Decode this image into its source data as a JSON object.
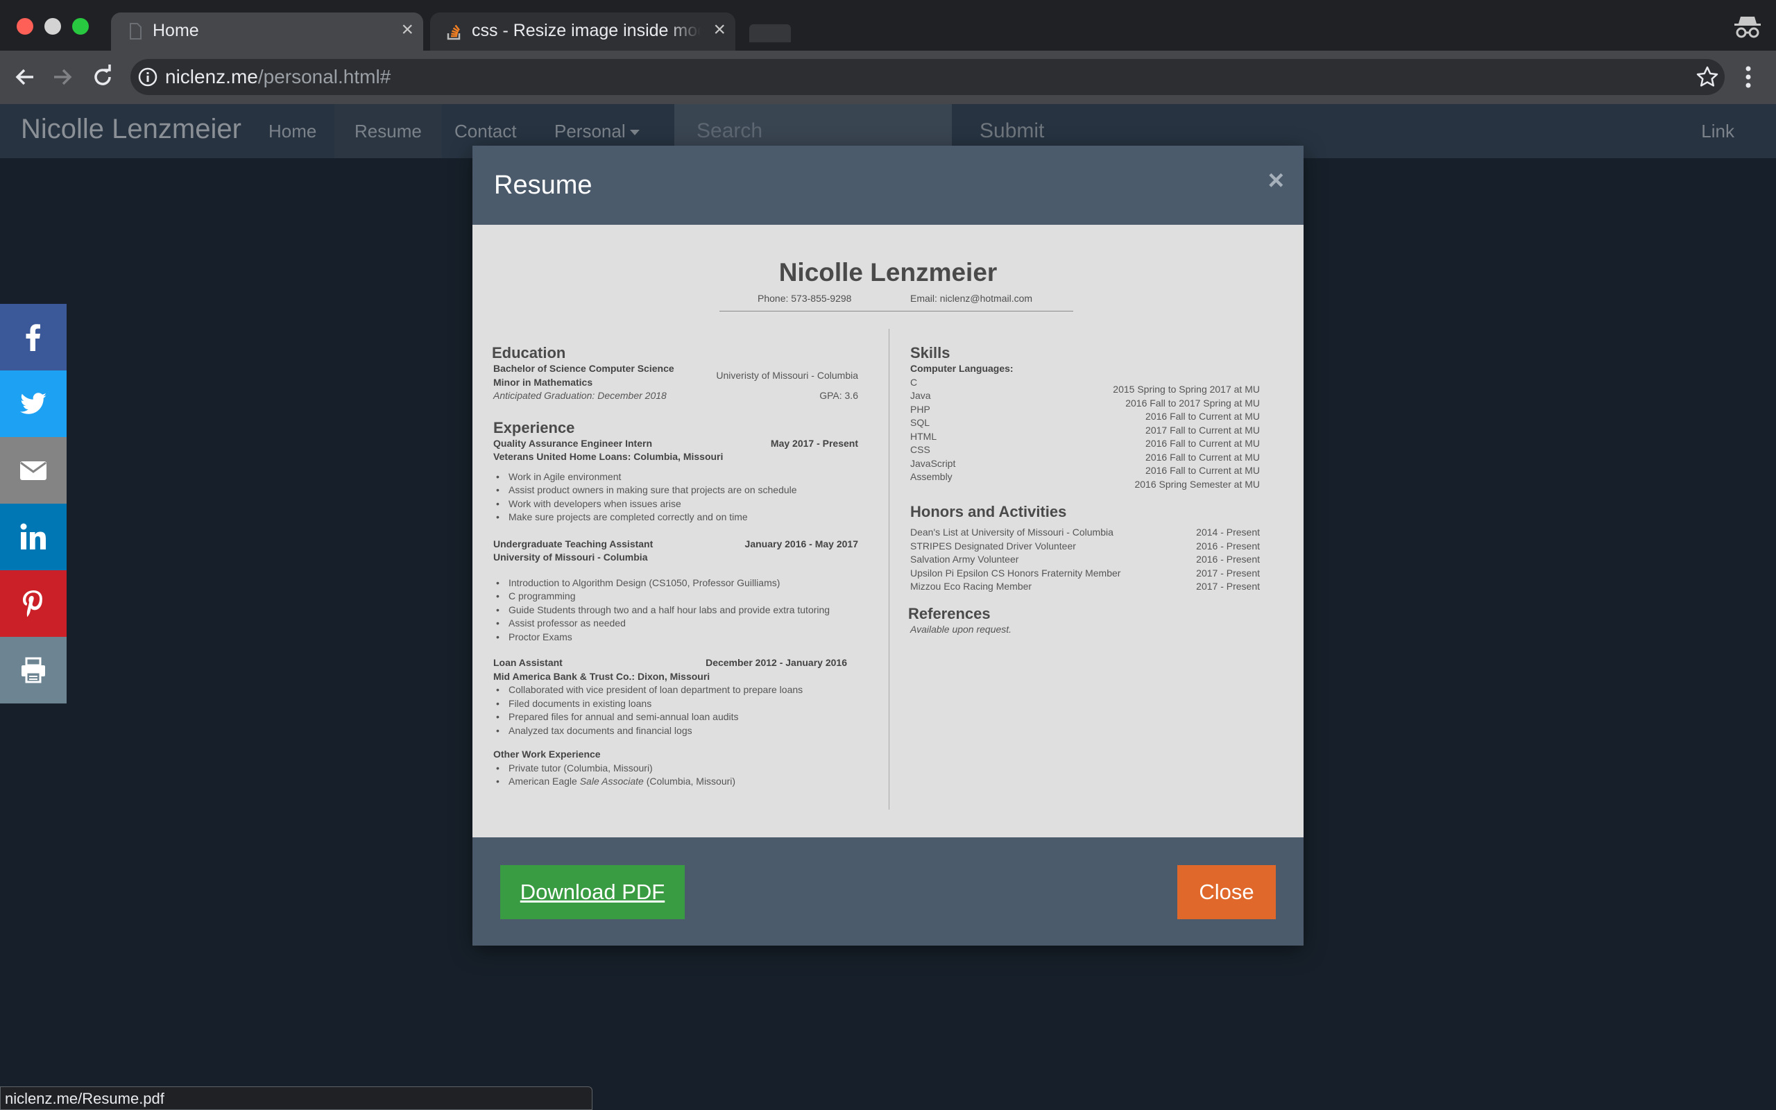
{
  "browser": {
    "tabs": [
      {
        "title": "Home"
      },
      {
        "title": "css - Resize image inside modal"
      }
    ],
    "url_host": "niclenz.me",
    "url_path": "/personal.html#"
  },
  "site": {
    "brand": "Nicolle Lenzmeier",
    "nav": [
      "Home",
      "Resume",
      "Contact",
      "Personal"
    ],
    "search_placeholder": "Search",
    "submit": "Submit",
    "link": "Link"
  },
  "modal": {
    "title": "Resume",
    "close_x": "×",
    "download_label": "Download PDF",
    "close_label": "Close"
  },
  "resume": {
    "name": "Nicolle Lenzmeier",
    "phone": "Phone: 573-855-9298",
    "email": "Email: niclenz@hotmail.com",
    "education": {
      "heading": "Education",
      "degree": "Bachelor of Science Computer Science",
      "minor": "Minor in Mathematics",
      "school": "Univeristy of Missouri - Columbia",
      "graduation": "Anticipated Graduation: December 2018",
      "gpa": "GPA: 3.6"
    },
    "experience": {
      "heading": "Experience",
      "jobs": [
        {
          "title": "Quality Assurance Engineer Intern",
          "dates": "May 2017 - Present",
          "company": "Veterans United Home Loans: Columbia, Missouri",
          "bullets": [
            "Work in Agile environment",
            "Assist product owners in making sure that projects are on schedule",
            "Work with developers when issues arise",
            "Make sure projects are completed correctly and on time"
          ]
        },
        {
          "title": "Undergraduate Teaching Assistant",
          "dates": "January 2016 - May 2017",
          "company": "University of Missouri - Columbia",
          "bullets": [
            "Introduction to Algorithm Design (CS1050, Professor Guilliams)",
            "C programming",
            "Guide Students through two and a half hour labs and provide extra tutoring",
            "Assist professor as needed",
            "Proctor Exams"
          ]
        },
        {
          "title": "Loan Assistant",
          "dates": "December 2012 - January 2016",
          "company": "Mid America Bank & Trust Co.: Dixon, Missouri",
          "bullets": [
            "Collaborated with vice president of loan department to prepare loans",
            "Filed documents in existing loans",
            "Prepared files for annual and semi-annual loan audits",
            "Analyzed tax documents and financial logs"
          ]
        }
      ],
      "other_heading": "Other Work Experience",
      "other": [
        "Private tutor (Columbia, Missouri)"
      ],
      "other_ae_prefix": "American Eagle ",
      "other_ae_italic": "Sale Associate",
      "other_ae_suffix": " (Columbia, Missouri)"
    },
    "skills": {
      "heading": "Skills",
      "subheading": "Computer Languages:",
      "items": [
        {
          "lang": "C",
          "when": ""
        },
        {
          "lang": "Java",
          "when": "2015 Spring to Spring 2017 at MU"
        },
        {
          "lang": "PHP",
          "when": "2016 Fall to 2017 Spring at MU"
        },
        {
          "lang": "SQL",
          "when": "2016 Fall to Current at MU"
        },
        {
          "lang": "HTML",
          "when": "2017 Fall to Current at MU"
        },
        {
          "lang": "CSS",
          "when": "2016 Fall to Current at MU"
        },
        {
          "lang": "JavaScript",
          "when": "2016 Fall to Current at MU"
        },
        {
          "lang": "Assembly",
          "when": "2016 Fall to Current at MU"
        },
        {
          "lang": "",
          "when": "2016 Spring Semester at MU"
        }
      ]
    },
    "honors": {
      "heading": "Honors and Activities",
      "items": [
        {
          "name": "Dean's List at University of Missouri - Columbia",
          "dates": "2014 - Present"
        },
        {
          "name": "STRIPES Designated Driver Volunteer",
          "dates": "2016 - Present"
        },
        {
          "name": "Salvation Army Volunteer",
          "dates": "2016 - Present"
        },
        {
          "name": "Upsilon Pi Epsilon CS Honors Fraternity Member",
          "dates": "2017 - Present"
        },
        {
          "name": "Mizzou Eco Racing Member",
          "dates": "2017 - Present"
        }
      ]
    },
    "references": {
      "heading": "References",
      "text": "Available upon request."
    }
  },
  "status_url": "niclenz.me/Resume.pdf"
}
